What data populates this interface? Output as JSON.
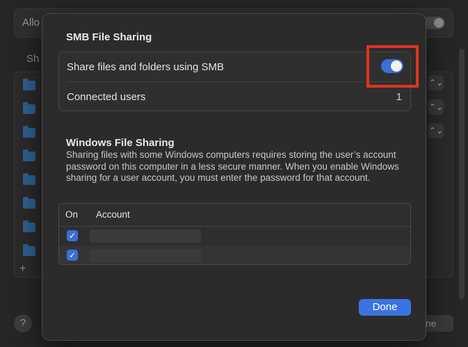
{
  "background": {
    "allow_label": "Allo",
    "shared_label": "Sh",
    "add_symbol": "+",
    "help_symbol": "?",
    "done_fragment": "ne",
    "stepper_symbol": "⌃⌄"
  },
  "smb": {
    "title": "SMB File Sharing",
    "share_label": "Share files and folders using SMB",
    "share_enabled": true,
    "connected_users_label": "Connected users",
    "connected_users_count": "1"
  },
  "windows": {
    "title": "Windows File Sharing",
    "description": "Sharing files with some Windows computers requires storing the user’s account password on this computer in a less secure manner. When you enable Windows sharing for a user account, you must enter the password for that account.",
    "columns": {
      "on": "On",
      "account": "Account"
    },
    "rows": [
      {
        "checked": true
      },
      {
        "checked": true
      }
    ]
  },
  "footer": {
    "done_label": "Done"
  },
  "colors": {
    "accent": "#3b74e0",
    "highlight": "#e0351f"
  }
}
